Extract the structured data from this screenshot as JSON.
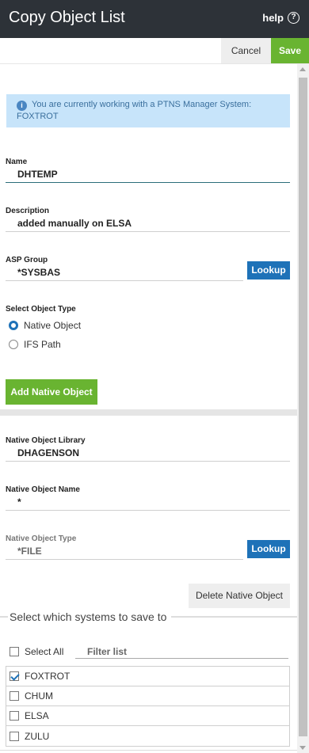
{
  "header": {
    "title": "Copy Object List",
    "help_label": "help",
    "help_icon": "?"
  },
  "toolbar": {
    "cancel_label": "Cancel",
    "save_label": "Save"
  },
  "info": {
    "icon": "i",
    "text": "You are currently working with a PTNS Manager System: FOXTROT"
  },
  "form": {
    "name": {
      "label": "Name",
      "value": "DHTEMP"
    },
    "description": {
      "label": "Description",
      "value": "added manually on ELSA"
    },
    "asp_group": {
      "label": "ASP Group",
      "value": "*SYSBAS",
      "lookup_label": "Lookup"
    },
    "object_type": {
      "label": "Select Object Type",
      "options": [
        {
          "label": "Native Object",
          "selected": true
        },
        {
          "label": "IFS Path",
          "selected": false
        }
      ]
    },
    "add_button_label": "Add Native Object"
  },
  "native": {
    "library": {
      "label": "Native Object Library",
      "value": "DHAGENSON"
    },
    "name": {
      "label": "Native Object Name",
      "value": "*"
    },
    "type": {
      "label": "Native Object Type",
      "value": "*FILE",
      "lookup_label": "Lookup"
    },
    "delete_label": "Delete Native Object"
  },
  "systems": {
    "title": "Select which systems to save to",
    "select_all_label": "Select All",
    "filter_placeholder": "Filter list",
    "items": [
      {
        "label": "FOXTROT",
        "checked": true
      },
      {
        "label": "CHUM",
        "checked": false
      },
      {
        "label": "ELSA",
        "checked": false
      },
      {
        "label": "ZULU",
        "checked": false
      }
    ]
  },
  "colors": {
    "header_bg": "#2d3238",
    "save_green": "#69b431",
    "lookup_blue": "#1e72b8",
    "info_bg": "#c7e4fa"
  }
}
